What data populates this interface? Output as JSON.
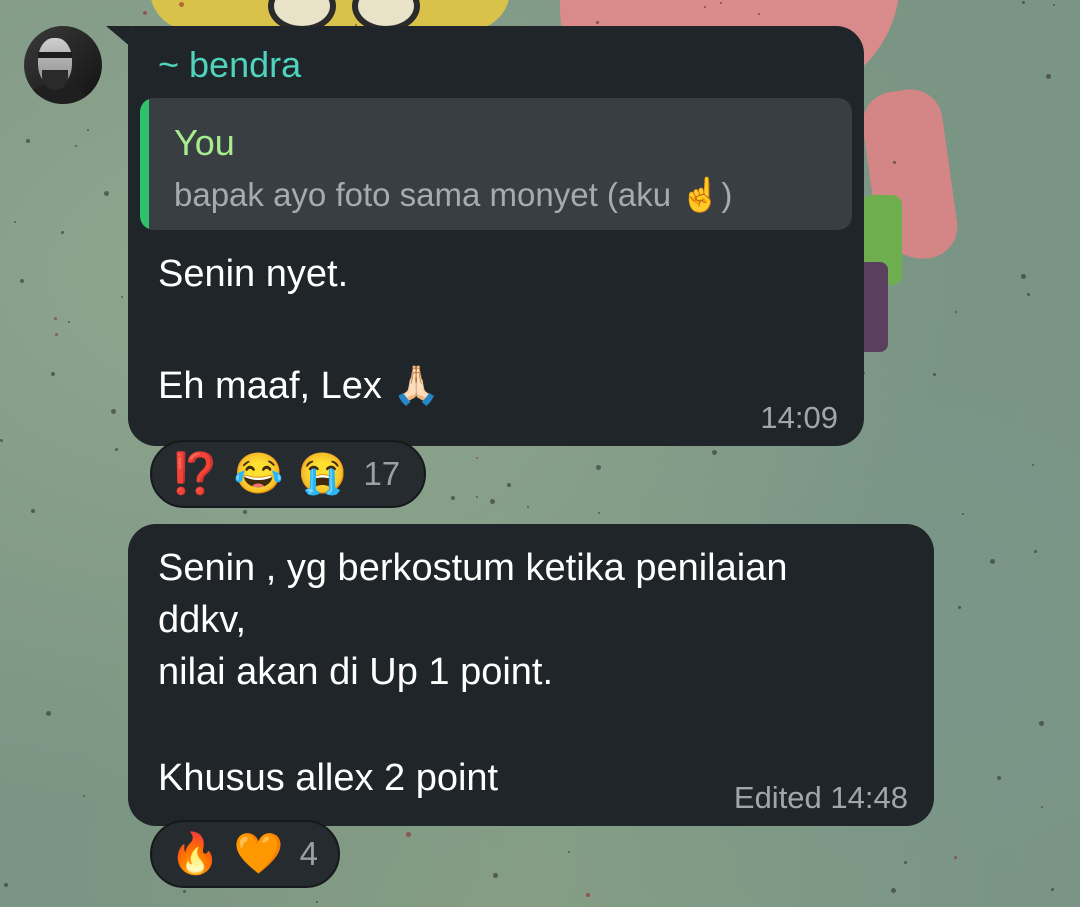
{
  "sender": {
    "prefix": "~",
    "name": "bendra"
  },
  "message1": {
    "reply": {
      "author": "You",
      "text": "bapak ayo foto sama monyet (aku ☝️)"
    },
    "lines": [
      "Senin nyet.",
      "",
      "Eh maaf, Lex 🙏🏻"
    ],
    "time": "14:09",
    "reactions": [
      "⁉️",
      "😂",
      "😭"
    ],
    "reaction_count": "17"
  },
  "message2": {
    "lines": [
      "Senin , yg berkostum ketika penilaian",
      "ddkv,",
      "nilai akan di Up 1 point.",
      "",
      "Khusus allex 2 point"
    ],
    "edited_label": "Edited",
    "time": "14:48",
    "reactions": [
      "🔥",
      "🧡"
    ],
    "reaction_count": "4"
  },
  "colors": {
    "bubble": "#1f2529",
    "sender_name": "#4fd3bd",
    "reply_author": "#a7ec8e",
    "reply_bar": "#2fc16b",
    "reply_bg": "#393e42"
  }
}
